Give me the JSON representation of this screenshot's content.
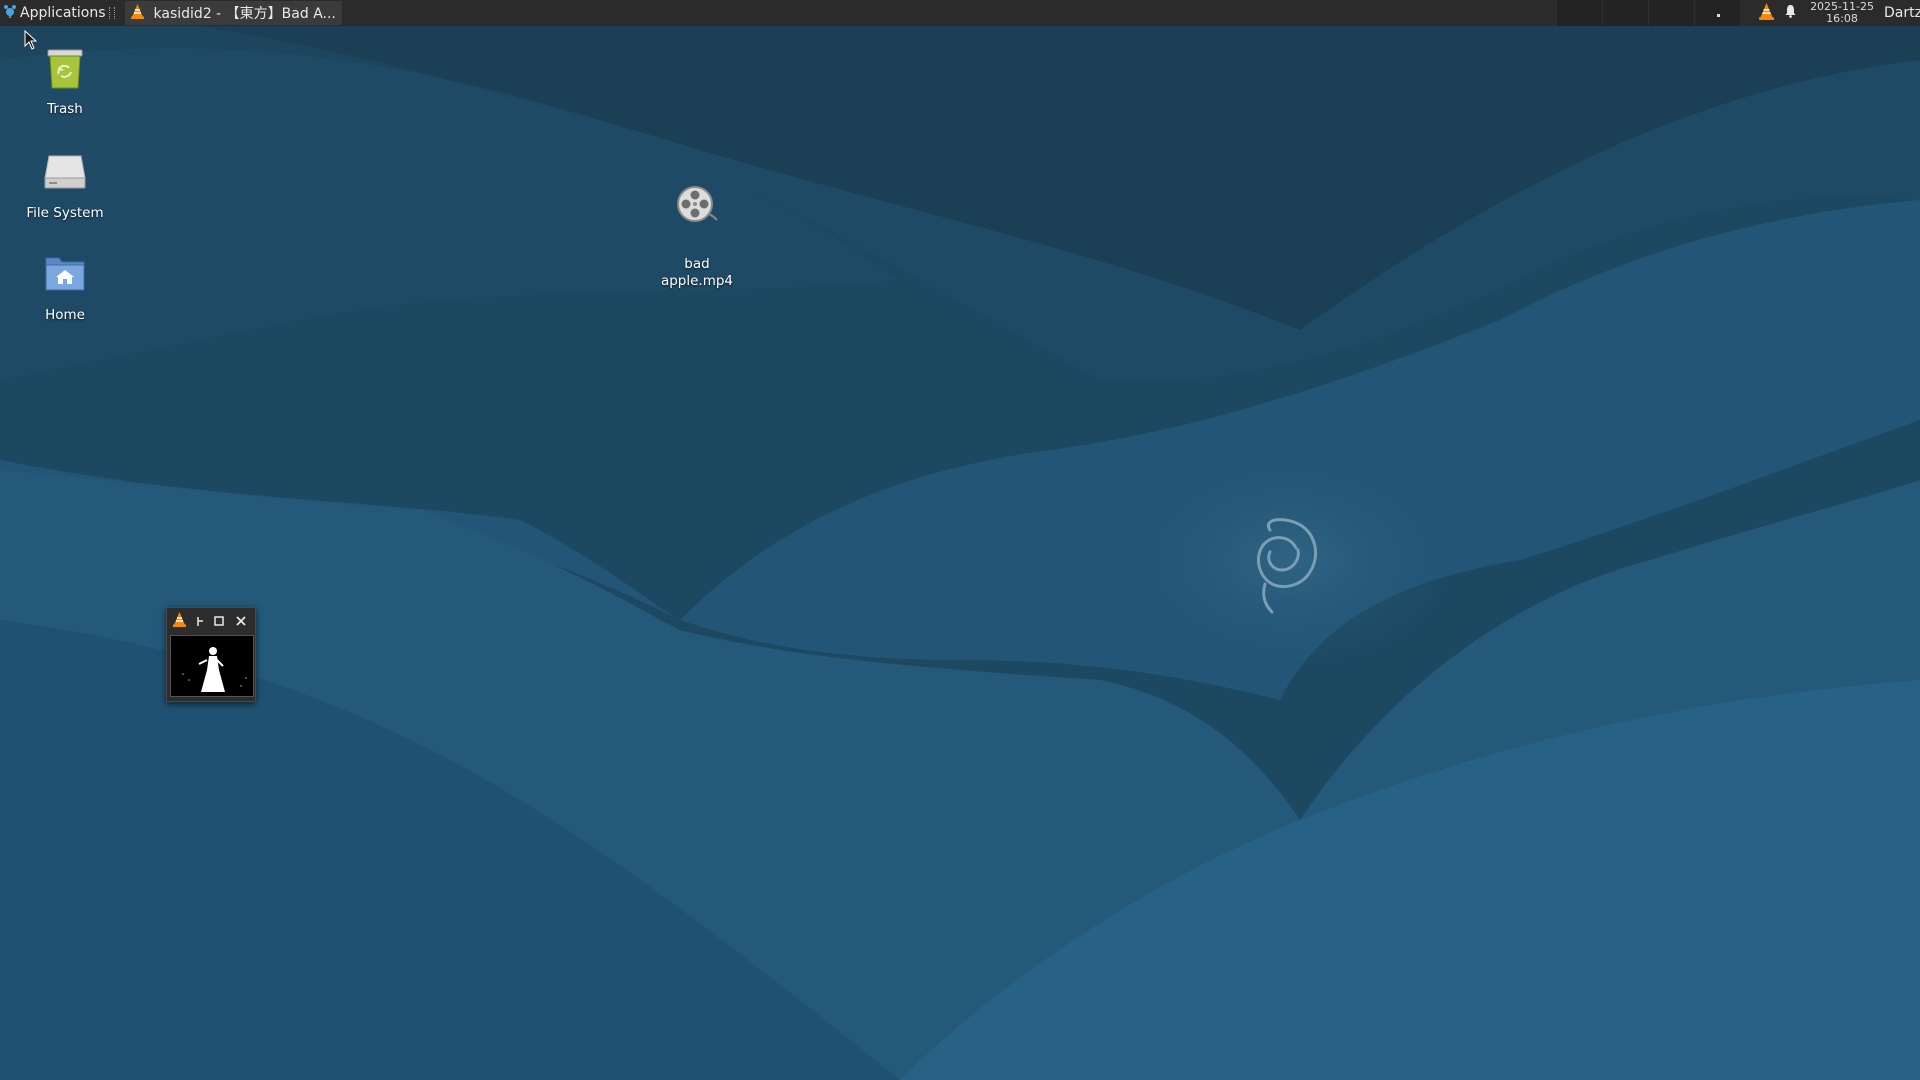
{
  "panel": {
    "applications_label": "Applications",
    "task_title": "kasidid2 - 【東方】Bad A...",
    "clock_date": "2025-11-25",
    "clock_time": "16:08",
    "user_label": "Dartz"
  },
  "desktop": {
    "icons": [
      {
        "label": "Trash",
        "icon": "trash-icon"
      },
      {
        "label": "File System",
        "icon": "drive-icon"
      },
      {
        "label": "Home",
        "icon": "home-folder-icon"
      },
      {
        "label": "bad\napple.mp4",
        "icon": "video-file-icon"
      }
    ]
  },
  "colors": {
    "panel_bg": "#2b2b2b",
    "wallpaper_base": "#1f4f6e",
    "vlc_orange": "#f58a07"
  }
}
